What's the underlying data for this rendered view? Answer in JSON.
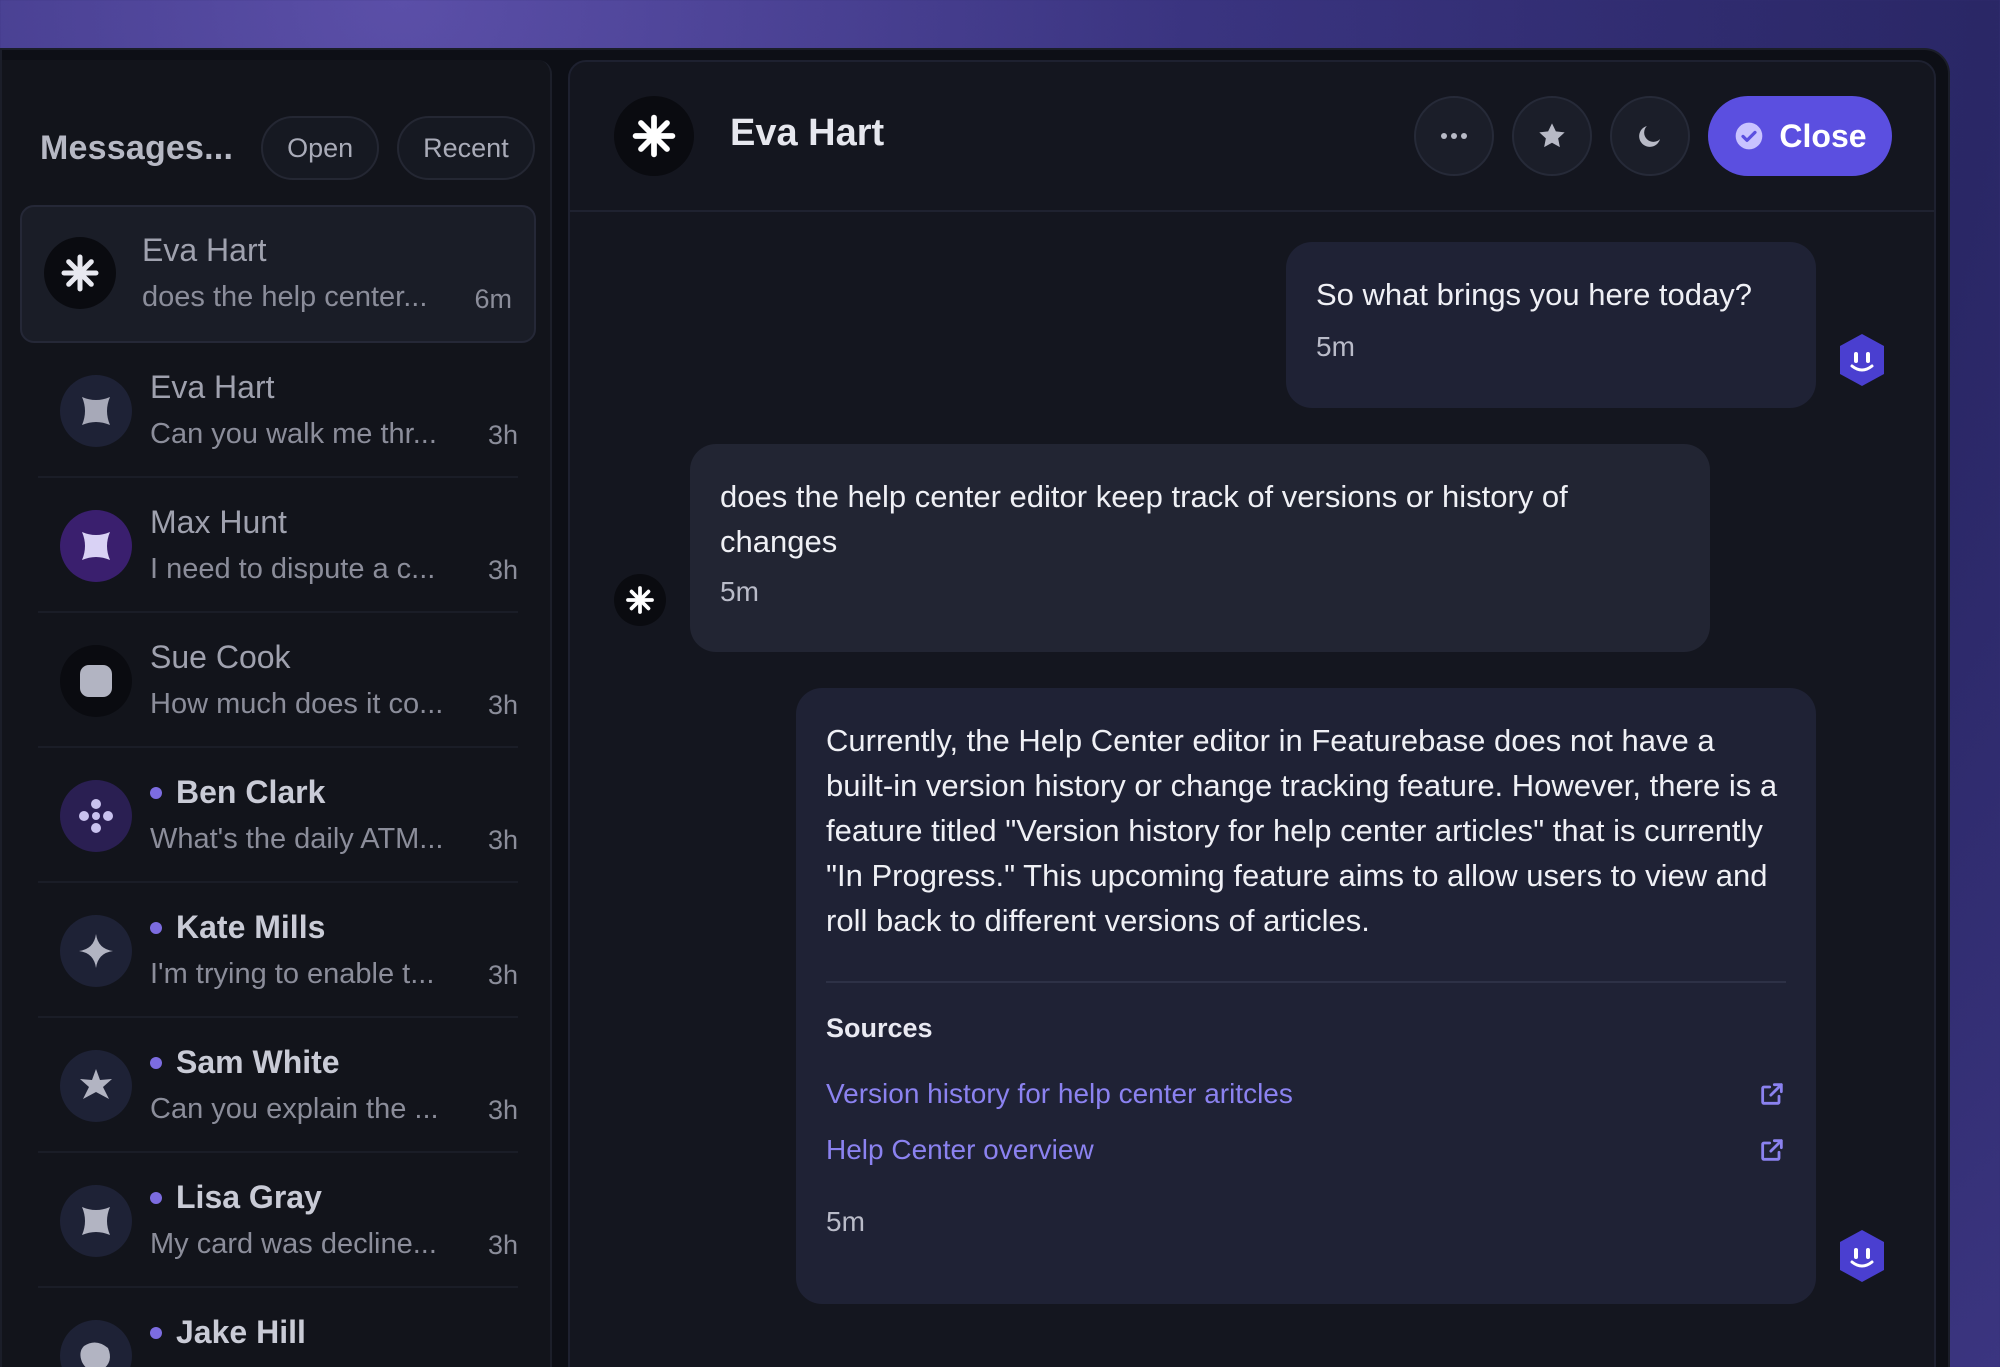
{
  "sidebar": {
    "title": "Messages...",
    "filters": [
      "Open",
      "Recent"
    ],
    "conversations": [
      {
        "name": "Eva Hart",
        "preview": "does the help center...",
        "time": "6m",
        "unread": false,
        "icon": "asterisk-icon",
        "avatar_bg": "#0a0b10"
      },
      {
        "name": "Eva Hart",
        "preview": "Can you walk me thr...",
        "time": "3h",
        "unread": false,
        "icon": "x-blob-icon",
        "avatar_bg": "#1e2236"
      },
      {
        "name": "Max Hunt",
        "preview": "I need to dispute a c...",
        "time": "3h",
        "unread": false,
        "icon": "x-blob-icon",
        "avatar_bg": "#3a1f6e"
      },
      {
        "name": "Sue Cook",
        "preview": "How much does it co...",
        "time": "3h",
        "unread": false,
        "icon": "rounded-square-icon",
        "avatar_bg": "#0a0b10"
      },
      {
        "name": "Ben Clark",
        "preview": "What's the daily ATM...",
        "time": "3h",
        "unread": true,
        "icon": "dots-cross-icon",
        "avatar_bg": "#2a1f52"
      },
      {
        "name": "Kate Mills",
        "preview": "I'm trying to enable t...",
        "time": "3h",
        "unread": true,
        "icon": "sparkle-icon",
        "avatar_bg": "#1e2236"
      },
      {
        "name": "Sam White",
        "preview": "Can you explain the ...",
        "time": "3h",
        "unread": true,
        "icon": "star6-icon",
        "avatar_bg": "#1e2236"
      },
      {
        "name": "Lisa Gray",
        "preview": "My card was decline...",
        "time": "3h",
        "unread": true,
        "icon": "x-blob-icon",
        "avatar_bg": "#1e2236"
      },
      {
        "name": "Jake Hill",
        "preview": "",
        "time": "",
        "unread": true,
        "icon": "blob-icon",
        "avatar_bg": "#1e2236"
      }
    ]
  },
  "header": {
    "name": "Eva Hart",
    "close_label": "Close"
  },
  "messages": [
    {
      "from": "agent",
      "text": "So what brings you here today?",
      "time": "5m"
    },
    {
      "from": "user",
      "text": "does the help center editor keep track of versions or history of changes",
      "time": "5m"
    },
    {
      "from": "agent",
      "text": "Currently, the Help Center editor in Featurebase does not have a built-in version history or change tracking feature. However, there is a feature titled \"Version history for help center articles\" that is currently \"In Progress.\" This upcoming feature aims to allow users to view and roll back to different versions of articles.",
      "time": "5m",
      "sources_title": "Sources",
      "sources": [
        "Version history for help center aritcles",
        "Help Center overview"
      ]
    }
  ],
  "colors": {
    "accent": "#5b4fe0",
    "link": "#8b82f0",
    "unread_dot": "#7c6ce0"
  }
}
